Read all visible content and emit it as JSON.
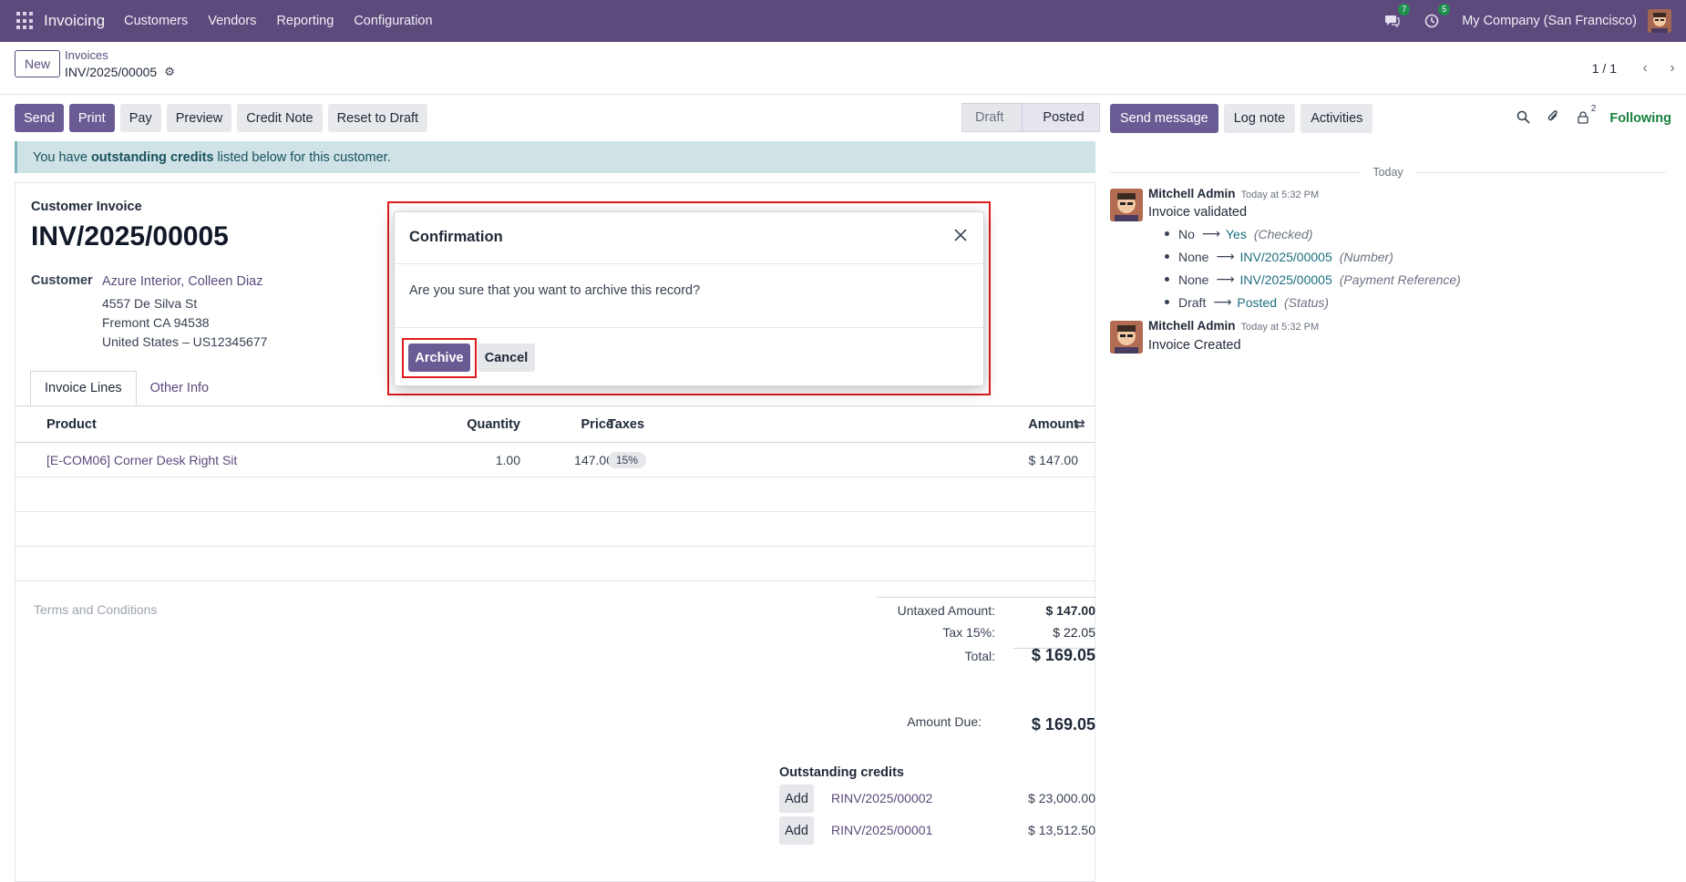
{
  "navbar": {
    "app_name": "Invoicing",
    "menu": [
      "Customers",
      "Vendors",
      "Reporting",
      "Configuration"
    ],
    "messages_count": "7",
    "activities_count": "5",
    "company": "My Company (San Francisco)"
  },
  "control_panel": {
    "new_label": "New",
    "breadcrumb_parent": "Invoices",
    "breadcrumb_current": "INV/2025/00005",
    "pager": "1 / 1"
  },
  "actions": {
    "send": "Send",
    "print": "Print",
    "pay": "Pay",
    "preview": "Preview",
    "credit_note": "Credit Note",
    "reset_to_draft": "Reset to Draft"
  },
  "statusbar": {
    "draft": "Draft",
    "posted": "Posted"
  },
  "alert": {
    "before": "You have",
    "bold": "outstanding credits",
    "after": "listed below for this customer."
  },
  "invoice": {
    "type": "Customer Invoice",
    "name": "INV/2025/00005",
    "customer_label": "Customer",
    "customer_name": "Azure Interior, Colleen Diaz",
    "address": [
      "4557 De Silva St",
      "Fremont CA 94538",
      "United States – US12345677"
    ]
  },
  "tabs": {
    "invoice_lines": "Invoice Lines",
    "other_info": "Other Info"
  },
  "table": {
    "headers": {
      "product": "Product",
      "quantity": "Quantity",
      "price": "Price",
      "taxes": "Taxes",
      "amount": "Amount"
    },
    "rows": [
      {
        "product": "[E-COM06] Corner Desk Right Sit",
        "quantity": "1.00",
        "price": "147.00",
        "tax": "15%",
        "amount": "$ 147.00"
      }
    ]
  },
  "terms_placeholder": "Terms and Conditions",
  "totals": {
    "untaxed_label": "Untaxed Amount:",
    "untaxed_value": "$ 147.00",
    "tax_label": "Tax 15%:",
    "tax_value": "$ 22.05",
    "total_label": "Total:",
    "total_value": "$ 169.05",
    "due_label": "Amount Due:",
    "due_value": "$ 169.05"
  },
  "outstanding": {
    "title": "Outstanding credits",
    "add_label": "Add",
    "items": [
      {
        "ref": "RINV/2025/00002",
        "amount": "$ 23,000.00"
      },
      {
        "ref": "RINV/2025/00001",
        "amount": "$ 13,512.50"
      }
    ]
  },
  "chatter": {
    "send_message": "Send message",
    "log_note": "Log note",
    "activities": "Activities",
    "followers_count": "2",
    "following": "Following",
    "today": "Today",
    "messages": [
      {
        "author": "Mitchell Admin",
        "date": "Today at 5:32 PM",
        "body": "Invoice validated",
        "changes": [
          {
            "old": "No",
            "new": "Yes",
            "field": "(Checked)"
          },
          {
            "old": "None",
            "new": "INV/2025/00005",
            "field": "(Number)"
          },
          {
            "old": "None",
            "new": "INV/2025/00005",
            "field": "(Payment Reference)"
          },
          {
            "old": "Draft",
            "new": "Posted",
            "field": "(Status)"
          }
        ]
      },
      {
        "author": "Mitchell Admin",
        "date": "Today at 5:32 PM",
        "body": "Invoice Created"
      }
    ]
  },
  "modal": {
    "title": "Confirmation",
    "message": "Are you sure that you want to archive this record?",
    "archive": "Archive",
    "cancel": "Cancel"
  },
  "colors": {
    "brand": "#5c4a7c",
    "primary_button": "#6b5b95",
    "highlight": "#e01b1b",
    "alert_bg": "#cfe2e6",
    "following": "#16803c"
  }
}
